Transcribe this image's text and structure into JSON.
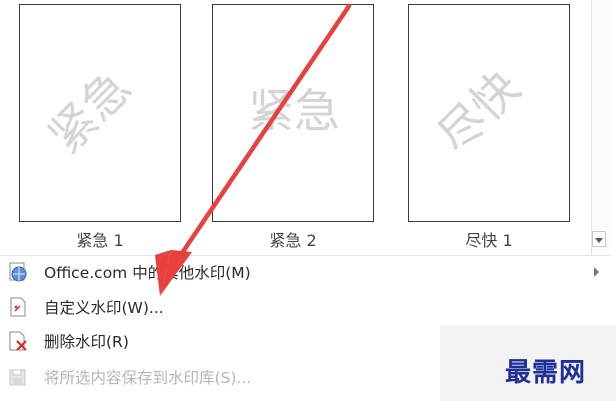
{
  "gallery": {
    "items": [
      {
        "watermark": "紧急",
        "caption": "紧急 1"
      },
      {
        "watermark": "紧急",
        "caption": "紧急 2"
      },
      {
        "watermark": "尽快",
        "caption": "尽快 1"
      }
    ]
  },
  "menu": {
    "items": [
      {
        "label": "Office.com 中的其他水印(M)",
        "icon": "globe-watermark-icon",
        "has_submenu": true,
        "enabled": true
      },
      {
        "label": "自定义水印(W)...",
        "icon": "custom-watermark-icon",
        "enabled": true
      },
      {
        "label": "删除水印(R)",
        "icon": "remove-watermark-icon",
        "enabled": true
      },
      {
        "label": "将所选内容保存到水印库(S)...",
        "icon": "save-to-gallery-icon",
        "enabled": false
      }
    ]
  },
  "brand": {
    "text": "最需网"
  },
  "colors": {
    "arrow": "#e8413d",
    "brand": "#1f2f9a",
    "watermark": "#d4d4d4"
  }
}
